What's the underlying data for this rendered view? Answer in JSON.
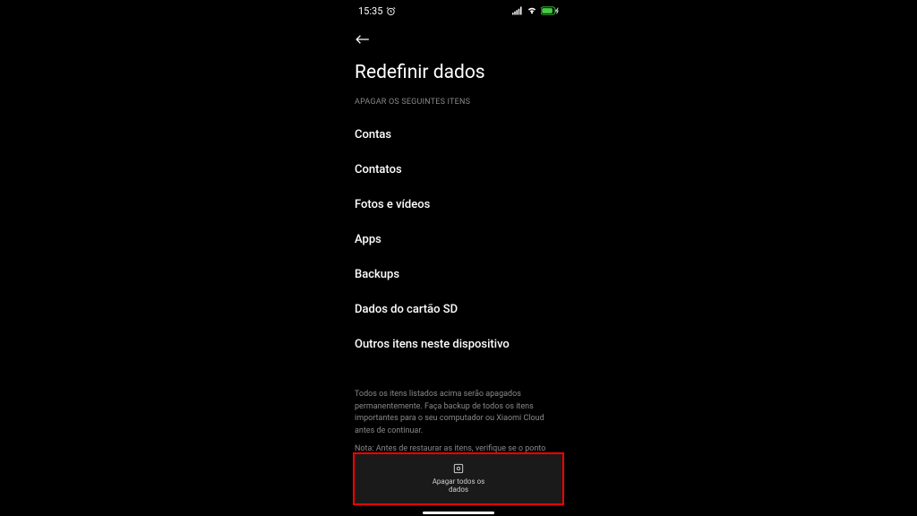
{
  "status": {
    "time": "15:35"
  },
  "header": {
    "title": "Redefinir dados"
  },
  "section": {
    "label": "APAGAR OS SEGUINTES ITENS"
  },
  "items": [
    "Contas",
    "Contatos",
    "Fotos e vídeos",
    "Apps",
    "Backups",
    "Dados do cartão SD",
    "Outros itens neste dispositivo"
  ],
  "description": "Todos os itens listados acima serão apagados permanentemente. Faça backup de todos os itens importantes para o seu computador ou Xiaomi Cloud antes de continuar.",
  "note": "Nota: Antes de restaurar as itens, verifique se o ponto",
  "button": {
    "label": "Apagar todos os dados"
  }
}
